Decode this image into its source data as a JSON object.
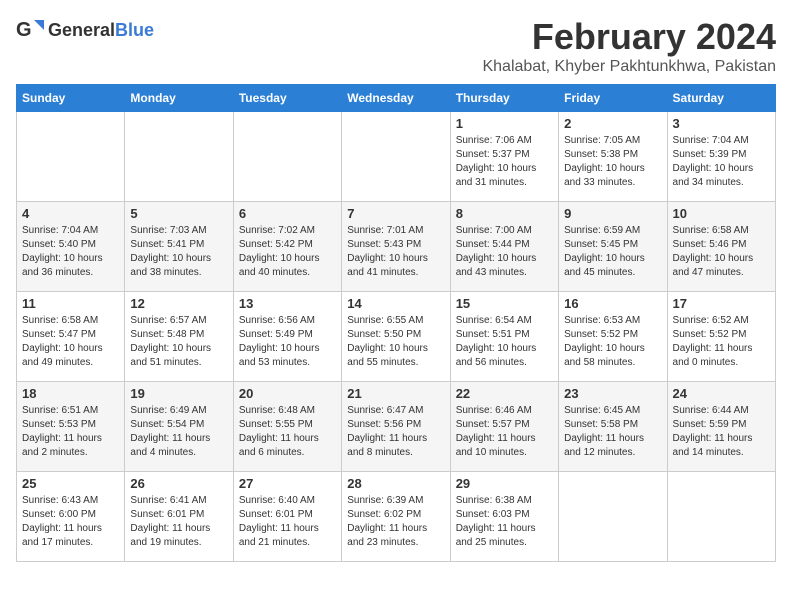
{
  "header": {
    "logo_general": "General",
    "logo_blue": "Blue",
    "month_title": "February 2024",
    "location": "Khalabat, Khyber Pakhtunkhwa, Pakistan"
  },
  "days_of_week": [
    "Sunday",
    "Monday",
    "Tuesday",
    "Wednesday",
    "Thursday",
    "Friday",
    "Saturday"
  ],
  "weeks": [
    [
      {
        "day": "",
        "info": ""
      },
      {
        "day": "",
        "info": ""
      },
      {
        "day": "",
        "info": ""
      },
      {
        "day": "",
        "info": ""
      },
      {
        "day": "1",
        "info": "Sunrise: 7:06 AM\nSunset: 5:37 PM\nDaylight: 10 hours and 31 minutes."
      },
      {
        "day": "2",
        "info": "Sunrise: 7:05 AM\nSunset: 5:38 PM\nDaylight: 10 hours and 33 minutes."
      },
      {
        "day": "3",
        "info": "Sunrise: 7:04 AM\nSunset: 5:39 PM\nDaylight: 10 hours and 34 minutes."
      }
    ],
    [
      {
        "day": "4",
        "info": "Sunrise: 7:04 AM\nSunset: 5:40 PM\nDaylight: 10 hours and 36 minutes."
      },
      {
        "day": "5",
        "info": "Sunrise: 7:03 AM\nSunset: 5:41 PM\nDaylight: 10 hours and 38 minutes."
      },
      {
        "day": "6",
        "info": "Sunrise: 7:02 AM\nSunset: 5:42 PM\nDaylight: 10 hours and 40 minutes."
      },
      {
        "day": "7",
        "info": "Sunrise: 7:01 AM\nSunset: 5:43 PM\nDaylight: 10 hours and 41 minutes."
      },
      {
        "day": "8",
        "info": "Sunrise: 7:00 AM\nSunset: 5:44 PM\nDaylight: 10 hours and 43 minutes."
      },
      {
        "day": "9",
        "info": "Sunrise: 6:59 AM\nSunset: 5:45 PM\nDaylight: 10 hours and 45 minutes."
      },
      {
        "day": "10",
        "info": "Sunrise: 6:58 AM\nSunset: 5:46 PM\nDaylight: 10 hours and 47 minutes."
      }
    ],
    [
      {
        "day": "11",
        "info": "Sunrise: 6:58 AM\nSunset: 5:47 PM\nDaylight: 10 hours and 49 minutes."
      },
      {
        "day": "12",
        "info": "Sunrise: 6:57 AM\nSunset: 5:48 PM\nDaylight: 10 hours and 51 minutes."
      },
      {
        "day": "13",
        "info": "Sunrise: 6:56 AM\nSunset: 5:49 PM\nDaylight: 10 hours and 53 minutes."
      },
      {
        "day": "14",
        "info": "Sunrise: 6:55 AM\nSunset: 5:50 PM\nDaylight: 10 hours and 55 minutes."
      },
      {
        "day": "15",
        "info": "Sunrise: 6:54 AM\nSunset: 5:51 PM\nDaylight: 10 hours and 56 minutes."
      },
      {
        "day": "16",
        "info": "Sunrise: 6:53 AM\nSunset: 5:52 PM\nDaylight: 10 hours and 58 minutes."
      },
      {
        "day": "17",
        "info": "Sunrise: 6:52 AM\nSunset: 5:52 PM\nDaylight: 11 hours and 0 minutes."
      }
    ],
    [
      {
        "day": "18",
        "info": "Sunrise: 6:51 AM\nSunset: 5:53 PM\nDaylight: 11 hours and 2 minutes."
      },
      {
        "day": "19",
        "info": "Sunrise: 6:49 AM\nSunset: 5:54 PM\nDaylight: 11 hours and 4 minutes."
      },
      {
        "day": "20",
        "info": "Sunrise: 6:48 AM\nSunset: 5:55 PM\nDaylight: 11 hours and 6 minutes."
      },
      {
        "day": "21",
        "info": "Sunrise: 6:47 AM\nSunset: 5:56 PM\nDaylight: 11 hours and 8 minutes."
      },
      {
        "day": "22",
        "info": "Sunrise: 6:46 AM\nSunset: 5:57 PM\nDaylight: 11 hours and 10 minutes."
      },
      {
        "day": "23",
        "info": "Sunrise: 6:45 AM\nSunset: 5:58 PM\nDaylight: 11 hours and 12 minutes."
      },
      {
        "day": "24",
        "info": "Sunrise: 6:44 AM\nSunset: 5:59 PM\nDaylight: 11 hours and 14 minutes."
      }
    ],
    [
      {
        "day": "25",
        "info": "Sunrise: 6:43 AM\nSunset: 6:00 PM\nDaylight: 11 hours and 17 minutes."
      },
      {
        "day": "26",
        "info": "Sunrise: 6:41 AM\nSunset: 6:01 PM\nDaylight: 11 hours and 19 minutes."
      },
      {
        "day": "27",
        "info": "Sunrise: 6:40 AM\nSunset: 6:01 PM\nDaylight: 11 hours and 21 minutes."
      },
      {
        "day": "28",
        "info": "Sunrise: 6:39 AM\nSunset: 6:02 PM\nDaylight: 11 hours and 23 minutes."
      },
      {
        "day": "29",
        "info": "Sunrise: 6:38 AM\nSunset: 6:03 PM\nDaylight: 11 hours and 25 minutes."
      },
      {
        "day": "",
        "info": ""
      },
      {
        "day": "",
        "info": ""
      }
    ]
  ]
}
